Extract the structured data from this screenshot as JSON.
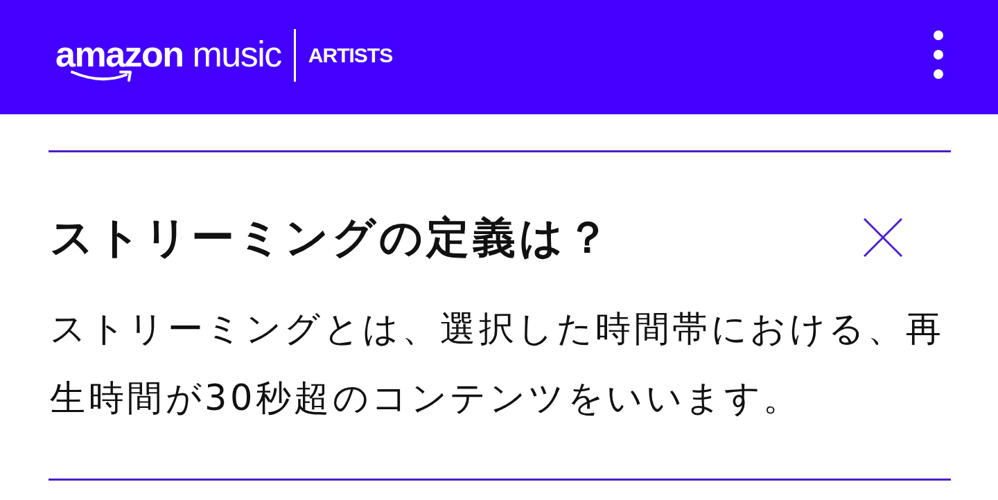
{
  "header": {
    "logo": {
      "wordmark": "**amazon** music",
      "section": "ARTISTS"
    }
  },
  "faq": {
    "question": "ストリーミングの定義は？",
    "answer": "ストリーミングとは、選択した時間帯における、再生時間が30秒超のコンテンツをいいます。",
    "expanded": true
  }
}
